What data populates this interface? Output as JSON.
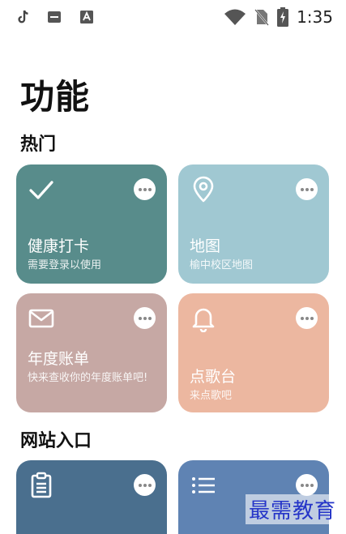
{
  "status_bar": {
    "time": "1:35",
    "left_icons": [
      "tiktok-icon",
      "app-icon",
      "a-icon"
    ],
    "right_icons": [
      "wifi-icon",
      "no-sim-icon",
      "battery-charging-icon"
    ]
  },
  "page": {
    "title": "功能"
  },
  "sections": {
    "hot": {
      "title": "热门",
      "cards": [
        {
          "title": "健康打卡",
          "subtitle": "需要登录以使用",
          "icon": "check-icon",
          "color": "#588c8b"
        },
        {
          "title": "地图",
          "subtitle": "榆中校区地图",
          "icon": "map-pin-icon",
          "color": "#a0c8d2"
        },
        {
          "title": "年度账单",
          "subtitle": "快来查收你的年度账单吧!",
          "icon": "mail-icon",
          "color": "#c6a8a4"
        },
        {
          "title": "点歌台",
          "subtitle": "来点歌吧",
          "icon": "bell-icon",
          "color": "#ecb7a0"
        }
      ]
    },
    "web": {
      "title": "网站入口",
      "cards": [
        {
          "icon": "clipboard-icon",
          "color": "#4a6f8e"
        },
        {
          "icon": "list-icon",
          "color": "#5f83b3"
        }
      ]
    }
  },
  "watermark": "最需教育"
}
